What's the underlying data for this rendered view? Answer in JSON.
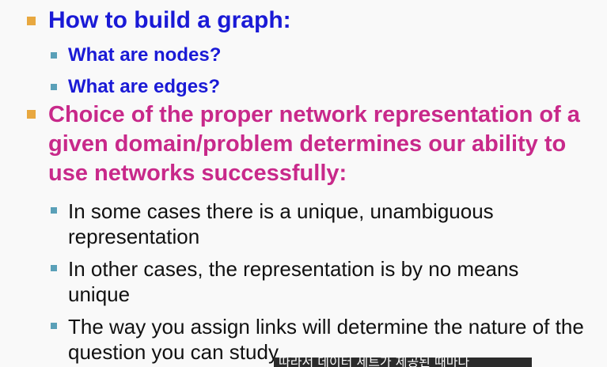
{
  "bullets": {
    "b1": "How to build a graph:",
    "b1_1": "What are nodes?",
    "b1_2": "What are edges?",
    "b2": "Choice of the proper network representation of a given domain/problem determines our ability to use networks successfully:",
    "b2_1": "In some cases there is a unique, unambiguous representation",
    "b2_2": "In other cases, the representation is by no means unique",
    "b2_3": "The way you assign links will determine the nature of the question you can study"
  },
  "subtitle": "따라서 데이터 세트가 제공된 때마다",
  "colors": {
    "heading_blue": "#1a1ad6",
    "emphasis_magenta": "#c8298a",
    "bullet_orange": "#e8a840",
    "bullet_teal": "#5aa0b8"
  }
}
